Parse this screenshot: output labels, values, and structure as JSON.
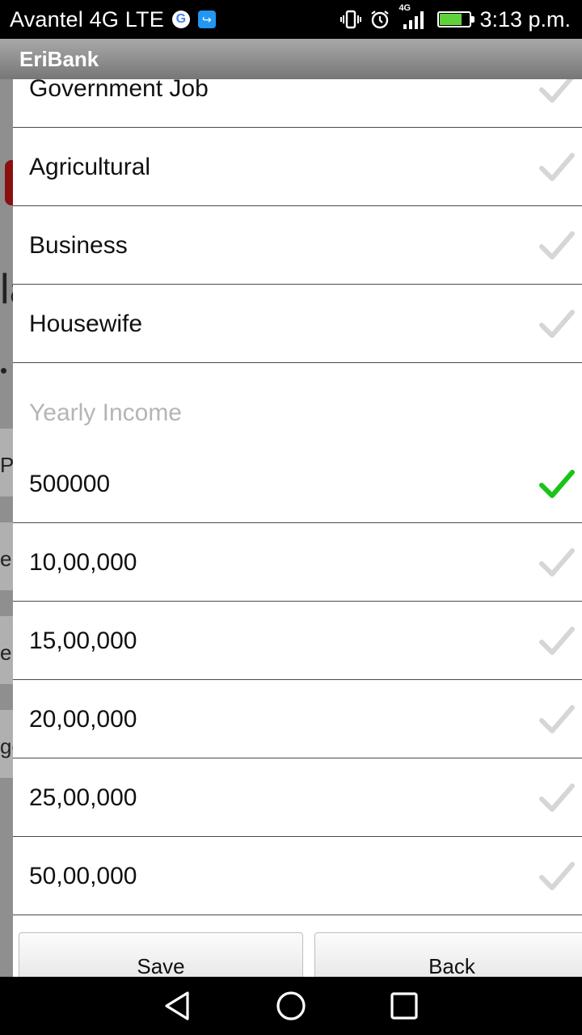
{
  "status_bar": {
    "carrier": "Avantel 4G LTE",
    "network_badge": "4G",
    "time": "3:13 p.m.",
    "battery_level": 0.75,
    "icons": [
      "google-icon",
      "usb-icon",
      "vibrate-icon",
      "alarm-icon",
      "signal-icon",
      "battery-icon"
    ]
  },
  "app": {
    "title": "EriBank"
  },
  "background_fragments": [
    "la",
    "Pa",
    "e",
    "e",
    "go"
  ],
  "occupation": {
    "items": [
      {
        "label": "Government Job",
        "checked": false
      },
      {
        "label": "Agricultural",
        "checked": false
      },
      {
        "label": "Business",
        "checked": false
      },
      {
        "label": "Housewife",
        "checked": false
      }
    ]
  },
  "income": {
    "header": "Yearly Income",
    "items": [
      {
        "label": "500000",
        "checked": true
      },
      {
        "label": "10,00,000",
        "checked": false
      },
      {
        "label": "15,00,000",
        "checked": false
      },
      {
        "label": "20,00,000",
        "checked": false
      },
      {
        "label": "25,00,000",
        "checked": false
      },
      {
        "label": "50,00,000",
        "checked": false
      }
    ]
  },
  "buttons": {
    "save_label": "Save",
    "back_label": "Back"
  },
  "colors": {
    "check_selected": "#19c419",
    "check_unselected": "#d6d6d6",
    "header_text": "#b5b5b5"
  }
}
